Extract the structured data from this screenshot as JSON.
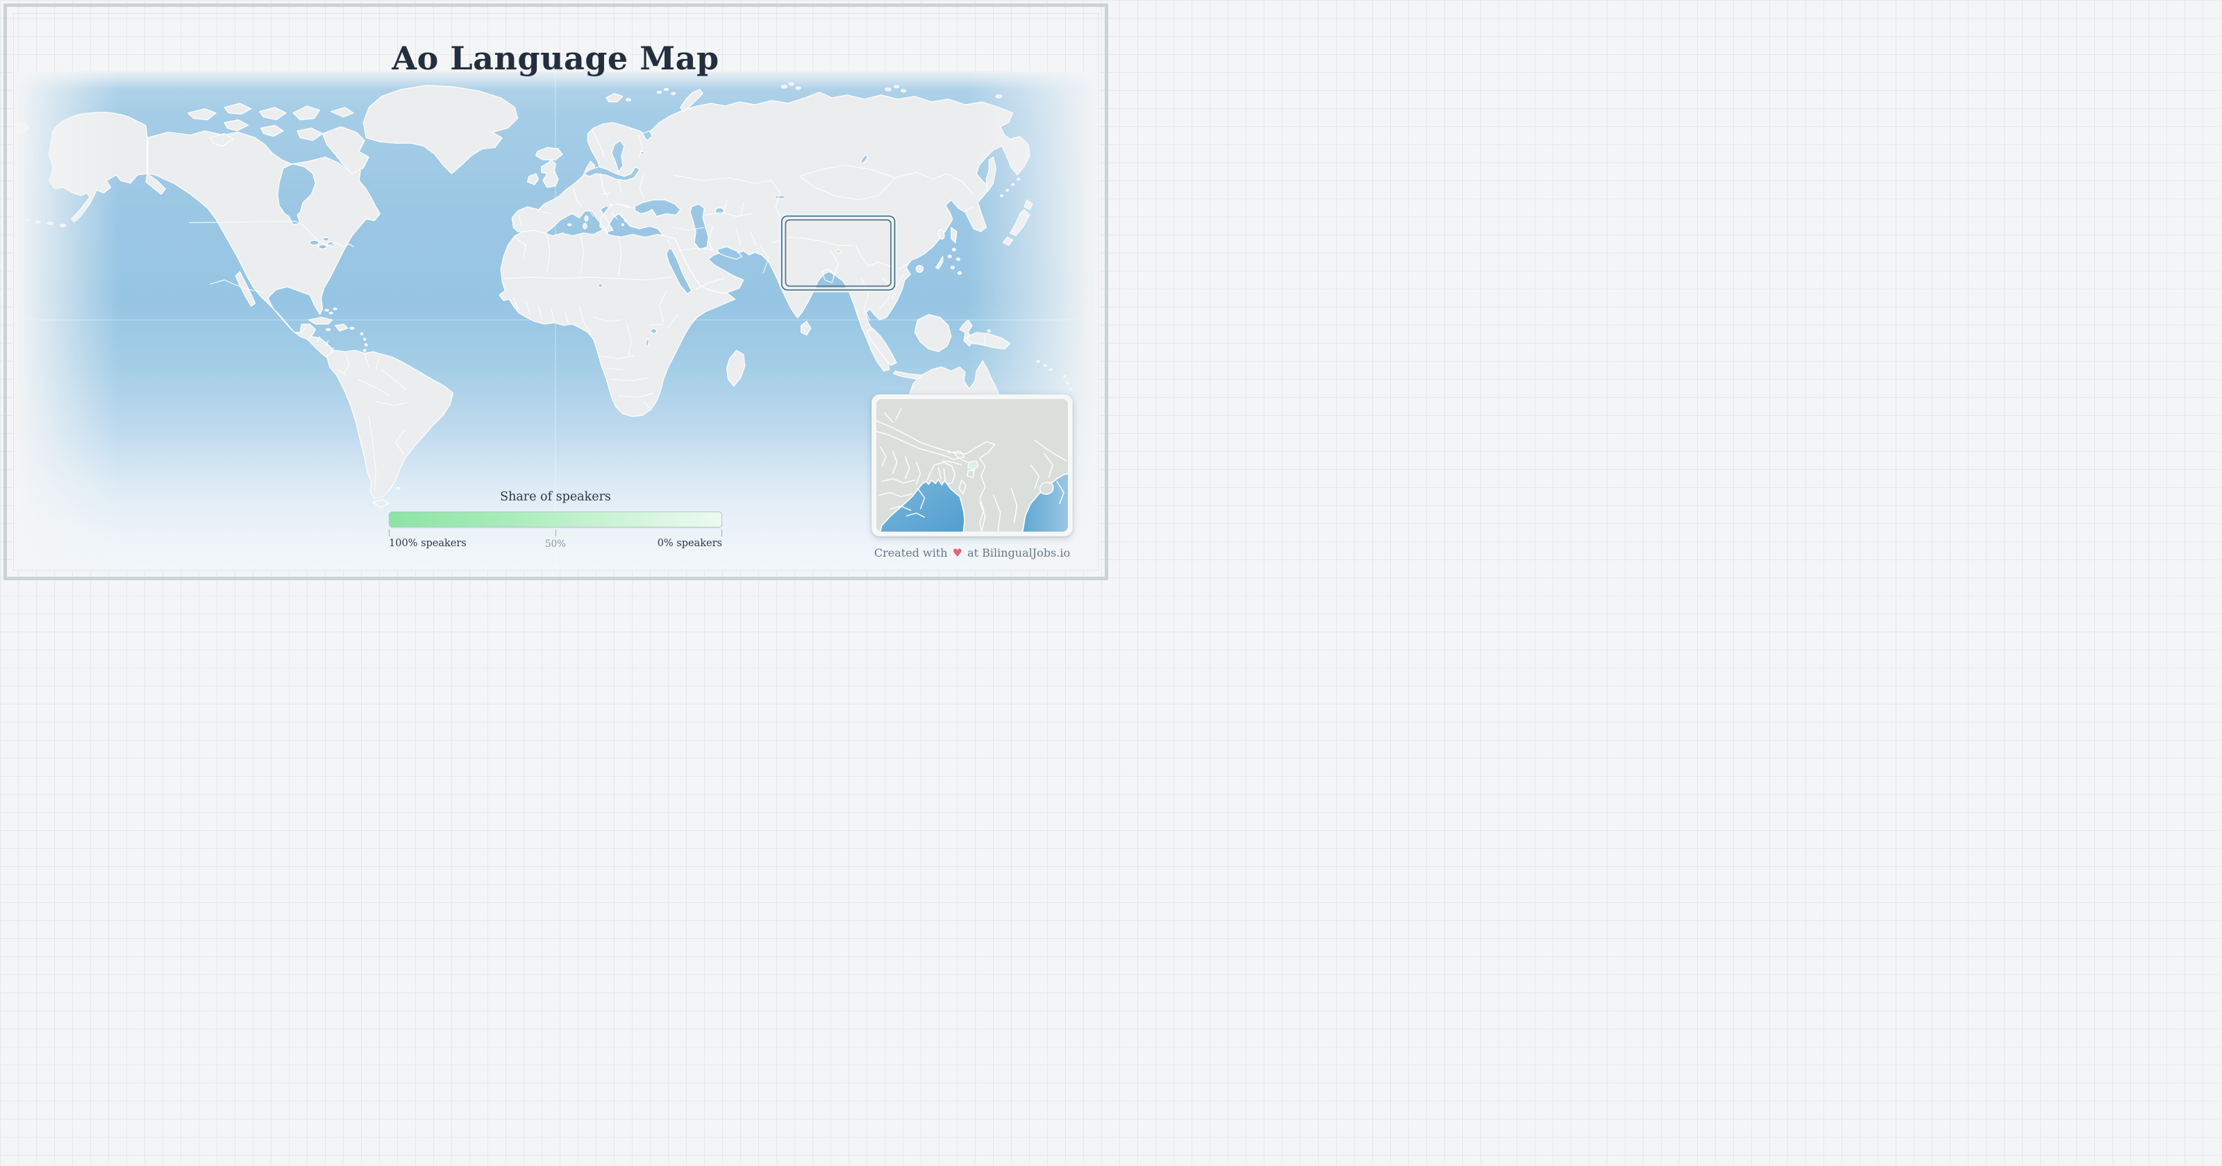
{
  "page": {
    "title": "Ao Language Map"
  },
  "legend": {
    "title": "Share of speakers",
    "label_left": "100% speakers",
    "label_mid": "50%",
    "label_right": "0% speakers",
    "gradient_start_color": "#8ce4a4",
    "gradient_end_color": "#edfaf0"
  },
  "footer": {
    "prefix": "Created with",
    "heart": "♥",
    "suffix": "at BilingualJobs.io",
    "heart_color": "#e4647e"
  },
  "map": {
    "land_color": "#ebedee",
    "ocean_color": "#9bc7e4",
    "border_color": "#ffffff",
    "viewport_box_color": "#4d7186",
    "highlight_region_color": "#d9f1e1",
    "inset_land_color": "#dbdfdc",
    "inset_water_color": "#55a2d1"
  }
}
